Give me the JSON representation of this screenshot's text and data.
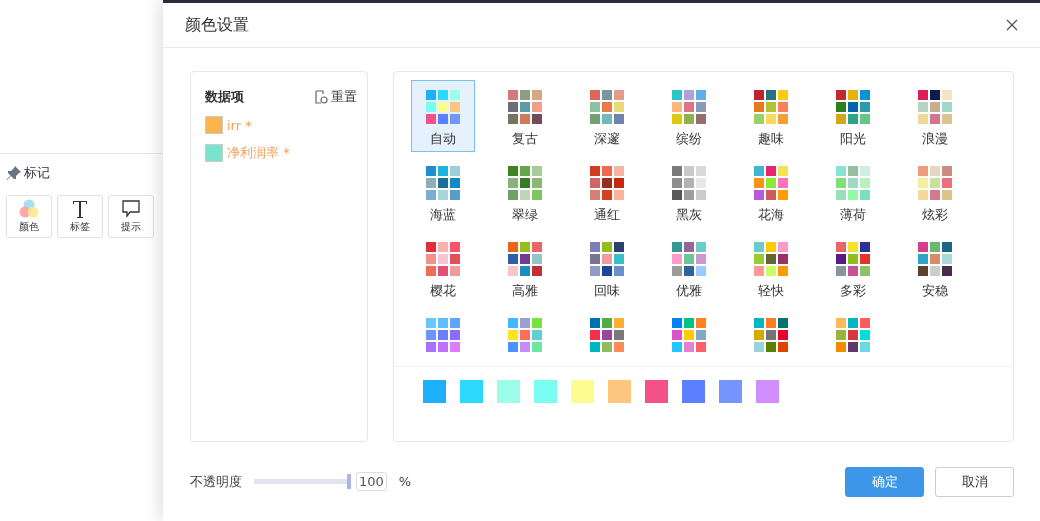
{
  "sidebar": {
    "section_title": "标记",
    "tools": [
      {
        "label": "颜色",
        "kind": "color"
      },
      {
        "label": "标签",
        "kind": "text"
      },
      {
        "label": "提示",
        "kind": "tooltip"
      }
    ]
  },
  "dialog": {
    "title": "颜色设置"
  },
  "data_items": {
    "title": "数据项",
    "reset": "重置",
    "items": [
      {
        "label": "irr *",
        "color": "#fcb54b"
      },
      {
        "label": "净利润率 *",
        "color": "#7ae3cb"
      }
    ]
  },
  "palettes": [
    {
      "name": "自动",
      "selected": true,
      "swatches": [
        {
          "color": "#1eb0fc"
        },
        {
          "color": "#2ed9ff"
        },
        {
          "color": "#9cfde9"
        },
        {
          "color": "#79fef1"
        },
        {
          "color": "#fdfc8f"
        },
        {
          "color": "#fdc67f"
        },
        {
          "color": "#f25287"
        },
        {
          "color": "#5b7ffe"
        },
        {
          "color": "#7495ff"
        }
      ]
    },
    {
      "name": "复古",
      "selected": false,
      "swatches": [
        {
          "color": "#d47a7a"
        },
        {
          "color": "#8e9b86"
        },
        {
          "color": "#d5a883"
        },
        {
          "color": "#6b6e72"
        },
        {
          "color": "#5a9ba4"
        },
        {
          "color": "#eda08a"
        },
        {
          "color": "#77735f"
        },
        {
          "color": "#cf7b5b"
        },
        {
          "color": "#744a58"
        }
      ]
    },
    {
      "name": "深邃",
      "selected": false,
      "swatches": [
        {
          "color": "#dc6560"
        },
        {
          "color": "#7896a0"
        },
        {
          "color": "#e59c87"
        },
        {
          "color": "#8cc0a4"
        },
        {
          "color": "#e97a4a"
        },
        {
          "color": "#ecd779"
        },
        {
          "color": "#70a170"
        },
        {
          "color": "#73b8bd"
        },
        {
          "color": "#6e84aa"
        }
      ]
    },
    {
      "name": "缤纷",
      "selected": false,
      "swatches": [
        {
          "color": "#2ec5c8"
        },
        {
          "color": "#b1a0d9"
        },
        {
          "color": "#5eaee9"
        },
        {
          "color": "#fdb57f"
        },
        {
          "color": "#dc7682"
        },
        {
          "color": "#8a9aba"
        },
        {
          "color": "#e2c90f"
        },
        {
          "color": "#93b04d"
        },
        {
          "color": "#946e6c"
        }
      ]
    },
    {
      "name": "趣味",
      "selected": false,
      "swatches": [
        {
          "color": "#c0232c"
        },
        {
          "color": "#267380"
        },
        {
          "color": "#fccb10"
        },
        {
          "color": "#e97921"
        },
        {
          "color": "#b6c132"
        },
        {
          "color": "#fa7f5d"
        },
        {
          "color": "#9ccf64"
        },
        {
          "color": "#f8d85d"
        },
        {
          "color": "#f29f36"
        }
      ]
    },
    {
      "name": "阳光",
      "selected": false,
      "swatches": [
        {
          "color": "#c1282f"
        },
        {
          "color": "#e8b00a"
        },
        {
          "color": "#0294d6"
        },
        {
          "color": "#2a7f1f"
        },
        {
          "color": "#0363ad"
        },
        {
          "color": "#2e9ca8"
        },
        {
          "color": "#d1a81c"
        },
        {
          "color": "#2ea38a"
        },
        {
          "color": "#63c885"
        }
      ]
    },
    {
      "name": "浪漫",
      "selected": false,
      "swatches": [
        {
          "color": "#de1f55"
        },
        {
          "color": "#0b1c50"
        },
        {
          "color": "#f2e5c6"
        },
        {
          "color": "#b6d3c8"
        },
        {
          "color": "#c5b08e"
        },
        {
          "color": "#a2d8c7"
        },
        {
          "color": "#f0d898"
        },
        {
          "color": "#d4748e"
        },
        {
          "color": "#dbc48f"
        }
      ]
    },
    {
      "name": "海蓝",
      "selected": false,
      "swatches": [
        {
          "color": "#1b8fd2"
        },
        {
          "color": "#1db5e0"
        },
        {
          "color": "#9ccfdc"
        },
        {
          "color": "#8aaeba"
        },
        {
          "color": "#1e6e9c"
        },
        {
          "color": "#0f89c8"
        },
        {
          "color": "#79aed2"
        },
        {
          "color": "#a9d3dd"
        },
        {
          "color": "#5b9dc9"
        }
      ]
    },
    {
      "name": "翠绿",
      "selected": false,
      "swatches": [
        {
          "color": "#3e8423"
        },
        {
          "color": "#67a54b"
        },
        {
          "color": "#a8cb9b"
        },
        {
          "color": "#87b27a"
        },
        {
          "color": "#367c27"
        },
        {
          "color": "#89b872"
        },
        {
          "color": "#73a06a"
        },
        {
          "color": "#c0d5b8"
        },
        {
          "color": "#7cc65d"
        }
      ]
    },
    {
      "name": "通红",
      "selected": false,
      "swatches": [
        {
          "color": "#d33c1e"
        },
        {
          "color": "#f0694c"
        },
        {
          "color": "#f6b4a7"
        },
        {
          "color": "#d06468"
        },
        {
          "color": "#992d1f"
        },
        {
          "color": "#c52a0c"
        },
        {
          "color": "#d67f75"
        },
        {
          "color": "#d6401f"
        },
        {
          "color": "#fbb39f"
        }
      ]
    },
    {
      "name": "黑灰",
      "selected": false,
      "swatches": [
        {
          "color": "#7a7a7a"
        },
        {
          "color": "#c9c9c9"
        },
        {
          "color": "#d9d9d9"
        },
        {
          "color": "#8e8e8e"
        },
        {
          "color": "#b3b3b3"
        },
        {
          "color": "#e8e8e8"
        },
        {
          "color": "#595959"
        },
        {
          "color": "#9e9e9e"
        },
        {
          "color": "#cccccc"
        }
      ]
    },
    {
      "name": "花海",
      "selected": false,
      "swatches": [
        {
          "color": "#40b5d4"
        },
        {
          "color": "#e32670"
        },
        {
          "color": "#f3e352"
        },
        {
          "color": "#fd9315"
        },
        {
          "color": "#89e933"
        },
        {
          "color": "#fc72b8"
        },
        {
          "color": "#b65bd9"
        },
        {
          "color": "#cf5a5c"
        },
        {
          "color": "#ff9d00"
        }
      ]
    },
    {
      "name": "薄荷",
      "selected": false,
      "swatches": [
        {
          "color": "#84e6d1"
        },
        {
          "color": "#95bf9f"
        },
        {
          "color": "#ccf0dd"
        },
        {
          "color": "#7fe07a"
        },
        {
          "color": "#a7d7c4"
        },
        {
          "color": "#b9f1be"
        },
        {
          "color": "#99dfb8"
        },
        {
          "color": "#95f8a5"
        },
        {
          "color": "#7ce1b8"
        }
      ]
    },
    {
      "name": "炫彩",
      "selected": false,
      "swatches": [
        {
          "color": "#ec9b7d"
        },
        {
          "color": "#e4d6c2"
        },
        {
          "color": "#cb8d82"
        },
        {
          "color": "#f2ef9e"
        },
        {
          "color": "#c6e29f"
        },
        {
          "color": "#f06f7b"
        },
        {
          "color": "#f3d99a"
        },
        {
          "color": "#d4798e"
        },
        {
          "color": "#ddc48e"
        }
      ]
    },
    {
      "name": "樱花",
      "selected": false,
      "swatches": [
        {
          "color": "#e32d3f"
        },
        {
          "color": "#f7b3ab"
        },
        {
          "color": "#fd5268"
        },
        {
          "color": "#f3918b"
        },
        {
          "color": "#f6c4d3"
        },
        {
          "color": "#e3505a"
        },
        {
          "color": "#f16b5b"
        },
        {
          "color": "#e2507a"
        },
        {
          "color": "#f19b9b"
        }
      ]
    },
    {
      "name": "高雅",
      "selected": false,
      "swatches": [
        {
          "color": "#e8651c"
        },
        {
          "color": "#95be1c"
        },
        {
          "color": "#e96668"
        },
        {
          "color": "#2f5fab"
        },
        {
          "color": "#6e3b95"
        },
        {
          "color": "#94c5c9"
        },
        {
          "color": "#f7c7c8"
        },
        {
          "color": "#1c8cbf"
        },
        {
          "color": "#c33033"
        }
      ]
    },
    {
      "name": "回味",
      "selected": false,
      "swatches": [
        {
          "color": "#7c7fb6"
        },
        {
          "color": "#91be1d"
        },
        {
          "color": "#2a416c"
        },
        {
          "color": "#737690"
        },
        {
          "color": "#f09b9b"
        },
        {
          "color": "#39bfc8"
        },
        {
          "color": "#929ac9"
        },
        {
          "color": "#1d4598"
        },
        {
          "color": "#6890cd"
        }
      ]
    },
    {
      "name": "优雅",
      "selected": false,
      "swatches": [
        {
          "color": "#339792"
        },
        {
          "color": "#94659a"
        },
        {
          "color": "#6acccb"
        },
        {
          "color": "#fd9ac9"
        },
        {
          "color": "#68c996"
        },
        {
          "color": "#cb99cd"
        },
        {
          "color": "#9a9a9a"
        },
        {
          "color": "#2e6598"
        },
        {
          "color": "#9acbfe"
        }
      ]
    },
    {
      "name": "轻快",
      "selected": false,
      "swatches": [
        {
          "color": "#6acbcb"
        },
        {
          "color": "#ffcb00"
        },
        {
          "color": "#fd9acb"
        },
        {
          "color": "#99cb33"
        },
        {
          "color": "#656532"
        },
        {
          "color": "#983265"
        },
        {
          "color": "#ff9898"
        },
        {
          "color": "#cbfe65"
        },
        {
          "color": "#ff9900"
        }
      ]
    },
    {
      "name": "多彩",
      "selected": false,
      "swatches": [
        {
          "color": "#e96568"
        },
        {
          "color": "#f4e12c"
        },
        {
          "color": "#2e3190"
        },
        {
          "color": "#5b1b84"
        },
        {
          "color": "#91be1d"
        },
        {
          "color": "#e7312b"
        },
        {
          "color": "#8a969c"
        },
        {
          "color": "#c8519b"
        },
        {
          "color": "#8ec165"
        }
      ]
    },
    {
      "name": "安稳",
      "selected": false,
      "swatches": [
        {
          "color": "#d53e8a"
        },
        {
          "color": "#6bb76f"
        },
        {
          "color": "#1b6684"
        },
        {
          "color": "#2ea3cc"
        },
        {
          "color": "#d58c67"
        },
        {
          "color": "#a8d8d8"
        },
        {
          "color": "#5c4030"
        },
        {
          "color": "#cccccc"
        },
        {
          "color": "#4a2a4f"
        }
      ]
    },
    {
      "selected": false,
      "swatches": [
        {
          "color": "#67c8ff"
        },
        {
          "color": "#5cbefd"
        },
        {
          "color": "#5ea5fe"
        },
        {
          "color": "#6996fe"
        },
        {
          "color": "#6b7efe"
        },
        {
          "color": "#8a6cfe"
        },
        {
          "color": "#a571fe"
        },
        {
          "color": "#c072fe"
        },
        {
          "color": "#e07afe"
        }
      ]
    },
    {
      "selected": false,
      "swatches": [
        {
          "color": "#3fb9fc"
        },
        {
          "color": "#9b9fd4"
        },
        {
          "color": "#77e23d"
        },
        {
          "color": "#fee323"
        },
        {
          "color": "#fe6f5b"
        },
        {
          "color": "#5fcfcf"
        },
        {
          "color": "#4c93fb"
        },
        {
          "color": "#c58dfd"
        },
        {
          "color": "#6ee7a3"
        }
      ]
    },
    {
      "selected": false,
      "swatches": [
        {
          "color": "#0070b3"
        },
        {
          "color": "#51ae45"
        },
        {
          "color": "#feae33"
        },
        {
          "color": "#f2304b"
        },
        {
          "color": "#954799"
        },
        {
          "color": "#7a7a7a"
        },
        {
          "color": "#00b5c2"
        },
        {
          "color": "#8fbb58"
        },
        {
          "color": "#ff8a5c"
        }
      ]
    },
    {
      "selected": false,
      "swatches": [
        {
          "color": "#0282f6"
        },
        {
          "color": "#00c485"
        },
        {
          "color": "#ff8222"
        },
        {
          "color": "#dc52c9"
        },
        {
          "color": "#fecc00"
        },
        {
          "color": "#82a9c0"
        },
        {
          "color": "#23c5fd"
        },
        {
          "color": "#e47fd4"
        },
        {
          "color": "#ff5e6c"
        }
      ]
    },
    {
      "selected": false,
      "swatches": [
        {
          "color": "#03b8bd"
        },
        {
          "color": "#fd7d27"
        },
        {
          "color": "#00726f"
        },
        {
          "color": "#d6a800"
        },
        {
          "color": "#747474"
        },
        {
          "color": "#e8002a"
        },
        {
          "color": "#98d3d7"
        },
        {
          "color": "#5a8000"
        },
        {
          "color": "#dd4400"
        }
      ]
    },
    {
      "selected": false,
      "swatches": [
        {
          "color": "#fdba58"
        },
        {
          "color": "#03b5c1"
        },
        {
          "color": "#fd5c5e"
        },
        {
          "color": "#9ab33c"
        },
        {
          "color": "#d7373c"
        },
        {
          "color": "#00dedb"
        },
        {
          "color": "#f48c00"
        },
        {
          "color": "#613968"
        },
        {
          "color": "#6cd9e6"
        }
      ]
    }
  ],
  "current_colors": [
    {
      "color": "#1eb0fc"
    },
    {
      "color": "#2ed9ff"
    },
    {
      "color": "#9cfde9"
    },
    {
      "color": "#79fef1"
    },
    {
      "color": "#fdfc8f"
    },
    {
      "color": "#fdc67f"
    },
    {
      "color": "#f25287"
    },
    {
      "color": "#5b7ffe"
    },
    {
      "color": "#7495ff"
    },
    {
      "color": "#d08eff"
    }
  ],
  "opacity": {
    "label": "不透明度",
    "level": 1,
    "value": "100",
    "unit": "%"
  },
  "buttons": [
    {
      "label": "确定",
      "kind": "primary"
    },
    {
      "label": "取消",
      "kind": "default"
    }
  ]
}
